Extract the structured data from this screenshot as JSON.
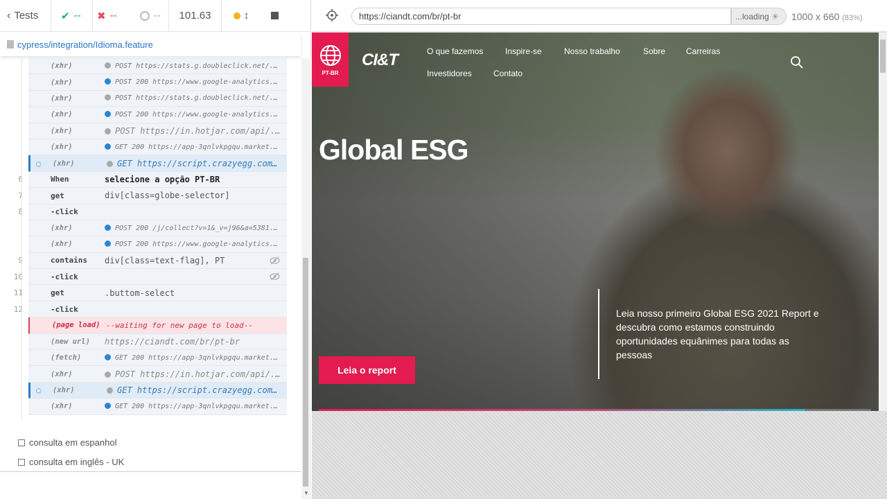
{
  "runner": {
    "tests_label": "Tests",
    "passed": "--",
    "failed": "--",
    "pending": "--",
    "duration": "101.63",
    "spec_file": "cypress/integration/Idioma.feature",
    "commands": [
      {
        "num": "",
        "name": "(xhr)",
        "msg": "POST https://stats.g.doubleclick.net/...",
        "dot": "gray",
        "style": "small"
      },
      {
        "num": "",
        "name": "(xhr)",
        "msg": "POST 200 https://www.google-analytics...",
        "dot": "blue",
        "style": "small"
      },
      {
        "num": "",
        "name": "(xhr)",
        "msg": "POST https://stats.g.doubleclick.net/...",
        "dot": "gray",
        "style": "small"
      },
      {
        "num": "",
        "name": "(xhr)",
        "msg": "POST 200 https://www.google-analytics...",
        "dot": "blue",
        "style": "small"
      },
      {
        "num": "",
        "name": "(xhr)",
        "msg": "POST https://in.hotjar.com/api/...",
        "dot": "gray",
        "style": "mid"
      },
      {
        "num": "",
        "name": "(xhr)",
        "msg": "GET 200 https://app-3qnlvkpgqu.market...",
        "dot": "blue",
        "style": "small"
      },
      {
        "num": "",
        "name": "(xhr)",
        "msg": "GET https://script.crazyegg.com...",
        "dot": "gray",
        "style": "pend"
      },
      {
        "num": "6",
        "name": "When",
        "msg": "selecione a opção PT-BR",
        "dot": "",
        "style": "bold"
      },
      {
        "num": "7",
        "name": "get",
        "msg": "div[class=globe-selector]",
        "dot": "",
        "style": "plain"
      },
      {
        "num": "8",
        "name": "-click",
        "msg": "",
        "dot": "",
        "style": "plain"
      },
      {
        "num": "",
        "name": "(xhr)",
        "msg": "POST 200 /j/collect?v=1&_v=j96&a=5381...",
        "dot": "blue",
        "style": "small"
      },
      {
        "num": "",
        "name": "(xhr)",
        "msg": "POST 200 https://www.google-analytics...",
        "dot": "blue",
        "style": "small"
      },
      {
        "num": "9",
        "name": "contains",
        "msg": "div[class=text-flag], PT",
        "dot": "",
        "style": "plain",
        "eye": true
      },
      {
        "num": "10",
        "name": "-click",
        "msg": "",
        "dot": "",
        "style": "plain",
        "eye": true
      },
      {
        "num": "11",
        "name": "get",
        "msg": ".buttom-select",
        "dot": "",
        "style": "plain"
      },
      {
        "num": "12",
        "name": "-click",
        "msg": "",
        "dot": "",
        "style": "plain"
      },
      {
        "num": "",
        "name": "(page load)",
        "msg": "--waiting for new page to load--",
        "dot": "",
        "style": "err"
      },
      {
        "num": "",
        "name": "(new url)",
        "msg": "https://ciandt.com/br/pt-br",
        "dot": "",
        "style": "newurl"
      },
      {
        "num": "",
        "name": "(fetch)",
        "msg": "GET 200 https://app-3qnlvkpgqu.market...",
        "dot": "blue",
        "style": "small"
      },
      {
        "num": "",
        "name": "(xhr)",
        "msg": "POST https://in.hotjar.com/api/...",
        "dot": "gray",
        "style": "mid"
      },
      {
        "num": "",
        "name": "(xhr)",
        "msg": "GET https://script.crazyegg.com...",
        "dot": "gray",
        "style": "pend"
      },
      {
        "num": "",
        "name": "(xhr)",
        "msg": "GET 200 https://app-3qnlvkpgqu.market...",
        "dot": "blue",
        "style": "small"
      }
    ],
    "other_tests": [
      "consulta em espanhol",
      "consulta em inglês - UK"
    ]
  },
  "browser": {
    "url": "https://ciandt.com/br/pt-br",
    "loading": "...loading",
    "viewport": "1000 x 660",
    "scale": "(83%)"
  },
  "site": {
    "lang": "PT-BR",
    "logo": "CI&T",
    "nav": [
      "O que fazemos",
      "Inspire-se",
      "Nosso trabalho",
      "Sobre",
      "Carreiras",
      "Investidores",
      "Contato"
    ],
    "hero_title": "Global ESG",
    "hero_text": "Leia nosso primeiro Global ESG 2021 Report e descubra como estamos construindo oportunidades equânimes para todas as pessoas",
    "cta": "Leia o report"
  },
  "colors": {
    "brand_red": "#e31b4f",
    "link_blue": "#2576c8",
    "pass_green": "#1fa971",
    "fail_red": "#e8445a"
  }
}
